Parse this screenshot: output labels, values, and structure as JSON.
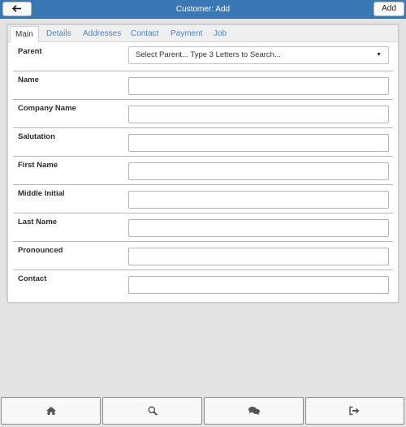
{
  "header": {
    "title": "Customer: Add",
    "back_icon": "arrow-left-icon",
    "add_label": "Add"
  },
  "tabs": [
    {
      "label": "Main",
      "active": true
    },
    {
      "label": "Details"
    },
    {
      "label": "Addresses"
    },
    {
      "label": "Contact"
    },
    {
      "label": "Payment"
    },
    {
      "label": "Job"
    }
  ],
  "form": {
    "parent": {
      "label": "Parent",
      "placeholder": "Select Parent... Type 3 Letters to Search..."
    },
    "name": {
      "label": "Name",
      "value": ""
    },
    "company_name": {
      "label": "Company Name",
      "value": ""
    },
    "salutation": {
      "label": "Salutation",
      "value": ""
    },
    "first_name": {
      "label": "First Name",
      "value": ""
    },
    "middle_initial": {
      "label": "Middle Initial",
      "value": ""
    },
    "last_name": {
      "label": "Last Name",
      "value": ""
    },
    "pronounced": {
      "label": "Pronounced",
      "value": ""
    },
    "contact": {
      "label": "Contact",
      "value": ""
    }
  },
  "footer": {
    "icons": [
      "home-icon",
      "search-icon",
      "chat-icon",
      "logout-icon"
    ]
  },
  "colors": {
    "header_bg": "#3a78b5",
    "tab_link": "#4a86c2",
    "page_bg": "#e3e3e3"
  }
}
